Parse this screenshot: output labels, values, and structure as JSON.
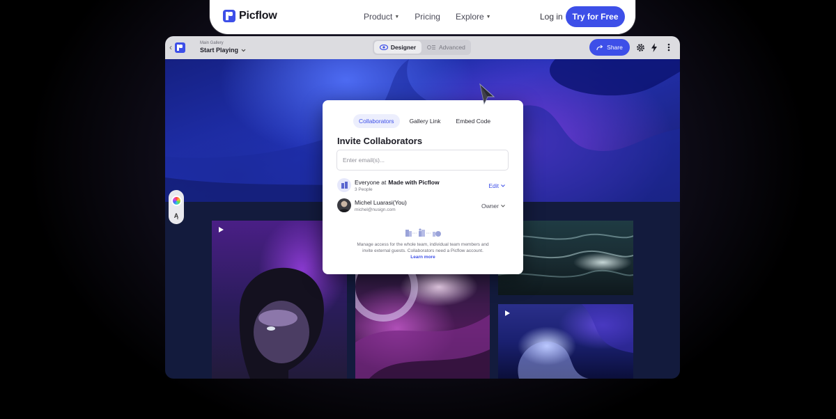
{
  "topnav": {
    "brand": "Picflow",
    "links": [
      "Product",
      "Pricing",
      "Explore"
    ],
    "login": "Log in",
    "cta": "Try for Free"
  },
  "toolbar": {
    "breadcrumb": "Main Gallery",
    "gallery_title": "Start Playing",
    "mode_designer": "Designer",
    "mode_advanced": "Advanced",
    "share": "Share"
  },
  "modal": {
    "tabs": [
      "Collaborators",
      "Gallery Link",
      "Embed Code"
    ],
    "active_tab": "Collaborators",
    "title": "Invite Collaborators",
    "email_placeholder": "Enter email(s)...",
    "team_row": {
      "prefix": "Everyone at",
      "org": "Made with Picflow",
      "sub": "3 People",
      "role": "Edit"
    },
    "user_row": {
      "name": "Michel Luarasi(You)",
      "email": "michel@nusign.com",
      "role": "Owner"
    },
    "footnote": "Manage access for the whole team, individual team members and invite external guests. Collaborators need a Picflow account.",
    "learn_more": "Learn more"
  },
  "colors": {
    "accent": "#3d4fe8",
    "app_background": "#131b3d"
  }
}
